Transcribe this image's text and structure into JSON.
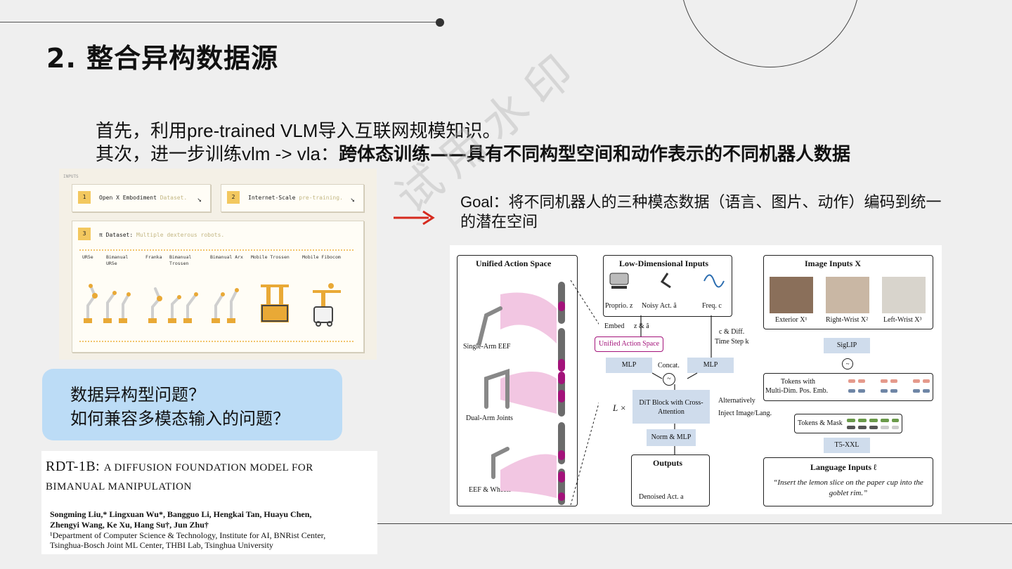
{
  "slide": {
    "title": "2. 整合异构数据源",
    "line1_a": "首先，利用",
    "line1_b": "pre-trained VLM",
    "line1_c": "导入互联网规模知识。",
    "line2_a": "其次，进一步训练",
    "line2_b": "vlm -> vla",
    "line2_c": "：",
    "line2_d": "跨体态训练——具有不同构型空间和动作表示的不同机器人数据",
    "goal_label": "Goal",
    "goal_text": "：将不同机器人的三种模态数据（语言、图片、动作）编码到统一的潜在空间",
    "bubble_q1": "数据异构型问题？",
    "bubble_q2": "如何兼容多模态输入的问题？",
    "watermark": "试用水印"
  },
  "inputs_panel": {
    "header": "INPUTS",
    "card1": {
      "num": "1",
      "label": "Open X Embodiment",
      "muted": "Dataset.",
      "arrow": "↘"
    },
    "card2": {
      "num": "2",
      "label": "Internet-Scale",
      "muted": "pre-training.",
      "arrow": "↘"
    },
    "card3": {
      "num": "3",
      "label": "π Dataset:",
      "muted": "Multiple dexterous robots."
    },
    "robots": [
      "UR5e",
      "Bimanual UR5e",
      "Franka",
      "Bimanual Trossen",
      "Bimanual Arx",
      "Mobile Trossen",
      "Mobile Fibocom"
    ]
  },
  "paper": {
    "title_l1a": "RDT-1B: ",
    "title_l1b": "A DIFFUSION FOUNDATION MODEL FOR",
    "title_l2": "BIMANUAL MANIPULATION",
    "authors_l1": "Songming Liu,* Lingxuan Wu*, Bangguo Li, Hengkai Tan, Huayu Chen,",
    "authors_l2": "Zhengyi Wang, Ke Xu, Hang Su†, Jun Zhu†",
    "aff_l1": "¹Department of Computer Science & Technology, Institute for AI, BNRist Center,",
    "aff_l2": "Tsinghua-Bosch Joint ML Center, THBI Lab, Tsinghua University"
  },
  "diagram": {
    "uas_title": "Unified Action Space",
    "single_arm": "Single-Arm EEF",
    "dual_arm": "Dual-Arm Joints",
    "eef_wheels": "EEF & Wheels",
    "low_dim_title": "Low-Dimensional Inputs",
    "proprio": "Proprio. z",
    "noisy": "Noisy Act. ã",
    "freq": "Freq. c",
    "embed": "Embed",
    "z_and_a": "z & ã",
    "c_diff": "c & Diff.",
    "timestep": "Time Step k",
    "uas_pill": "Unified Action Space",
    "mlp1": "MLP",
    "mlp2": "MLP",
    "concat": "Concat.",
    "lx": "L ×",
    "dit": "DiT Block with Cross-Attention",
    "alternatively": "Alternatively",
    "inject": "Inject Image/Lang.",
    "norm_mlp": "Norm & MLP",
    "outputs": "Outputs",
    "denoised": "Denoised Act. a",
    "image_title": "Image Inputs X",
    "exterior": "Exterior X¹",
    "right_wrist": "Right-Wrist X²",
    "left_wrist": "Left-Wrist X³",
    "siglip": "SigLIP",
    "tokens_with": "Tokens with",
    "multi_dim": "Multi-Dim. Pos. Emb.",
    "tokens_mask": "Tokens & Mask",
    "t5": "T5-XXL",
    "lang_title": "Language Inputs ℓ",
    "lang_text": "“Insert the lemon slice on the paper cup into the goblet rim.”"
  },
  "colors": {
    "bubble": "#bcdcf6",
    "card_num": "#f3c85f",
    "arrow_red": "#d62a1e",
    "pill_magenta": "#a3127a",
    "proj_blue": "#cfdcec"
  }
}
